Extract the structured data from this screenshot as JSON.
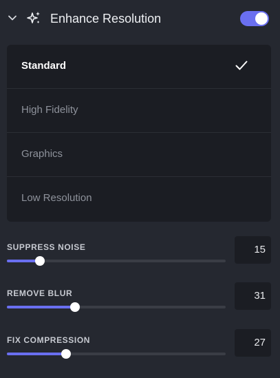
{
  "section": {
    "title": "Enhance Resolution",
    "enabled": true,
    "icons": {
      "collapse": "chevron-down-icon",
      "section": "sparkle-icon"
    }
  },
  "options": [
    {
      "label": "Standard",
      "selected": true
    },
    {
      "label": "High Fidelity",
      "selected": false
    },
    {
      "label": "Graphics",
      "selected": false
    },
    {
      "label": "Low Resolution",
      "selected": false
    }
  ],
  "sliders": [
    {
      "label": "SUPPRESS NOISE",
      "value": "15",
      "level": 15,
      "max": 100
    },
    {
      "label": "REMOVE BLUR",
      "value": "31",
      "level": 31,
      "max": 100
    },
    {
      "label": "FIX COMPRESSION",
      "value": "27",
      "level": 27,
      "max": 100
    }
  ],
  "colors": {
    "accent": "#6a6ff0",
    "background": "#252830",
    "panel": "#1b1d23"
  }
}
